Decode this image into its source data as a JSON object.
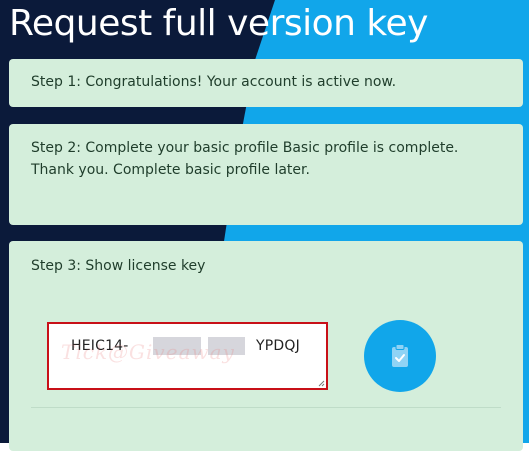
{
  "page": {
    "title": "Request full version key"
  },
  "steps": [
    {
      "text": "Step 1: Congratulations! Your account is active now."
    },
    {
      "text": "Step 2: Complete your basic profile Basic profile is complete. Thank you. Complete basic profile later."
    },
    {
      "text": "Step 3: Show license key"
    }
  ],
  "license": {
    "prefix": "HEIC14-",
    "suffix": "YPDQJ",
    "watermark": "Tick@Giveaway"
  },
  "copy_button": {
    "icon": "clipboard-check-icon"
  },
  "colors": {
    "background_dark": "#0b1a3a",
    "background_blue": "#11a6ea",
    "card": "#d4eedb",
    "highlight_border": "#c81018",
    "button": "#11a6ea"
  }
}
